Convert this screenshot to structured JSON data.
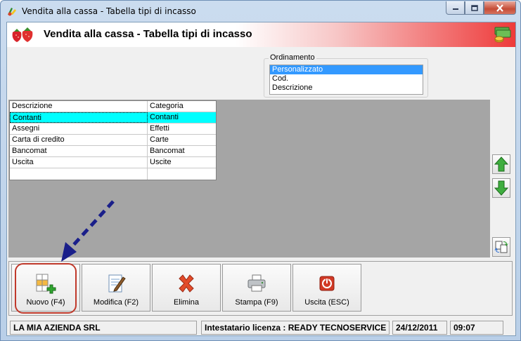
{
  "window": {
    "title": "Vendita alla cassa - Tabella tipi di incasso",
    "minimize_icon": "minimize-icon",
    "maximize_icon": "maximize-icon",
    "close_icon": "close-icon"
  },
  "header": {
    "heading": "Vendita alla cassa - Tabella tipi di incasso",
    "left_icon": "strawberry-icon",
    "right_icon": "money-icon"
  },
  "sorting": {
    "legend": "Ordinamento",
    "options": [
      "Personalizzato",
      "Cod.",
      "Descrizione"
    ],
    "selected": "Personalizzato"
  },
  "table": {
    "columns": [
      "Descrizione",
      "Categoria"
    ],
    "rows": [
      {
        "descrizione": "Contanti",
        "categoria": "Contanti"
      },
      {
        "descrizione": "Assegni",
        "categoria": "Effetti"
      },
      {
        "descrizione": "Carta di credito",
        "categoria": "Carte"
      },
      {
        "descrizione": "Bancomat",
        "categoria": "Bancomat"
      },
      {
        "descrizione": "Uscita",
        "categoria": "Uscite"
      }
    ],
    "selected_row": "Contanti"
  },
  "side_buttons": {
    "up_icon": "arrow-up-icon",
    "down_icon": "arrow-down-icon",
    "refresh_icon": "refresh-icon"
  },
  "toolbar": {
    "new_label": "Nuovo (F4)",
    "edit_label": "Modifica (F2)",
    "delete_label": "Elimina",
    "print_label": "Stampa (F9)",
    "exit_label": "Uscita (ESC)"
  },
  "status": {
    "company": "LA MIA AZIENDA SRL",
    "license": "Intestatario licenza : READY TECNOSERVICE",
    "date": "24/12/2011",
    "time": "09:07"
  },
  "colors": {
    "selection_row": "#00ffff",
    "list_selection": "#3399ff",
    "grid_background": "#a5a5a5",
    "header_gradient_end": "#ee3a3a",
    "annotation_arrow": "#1a1f8a",
    "annotation_ring": "#c0392b"
  }
}
